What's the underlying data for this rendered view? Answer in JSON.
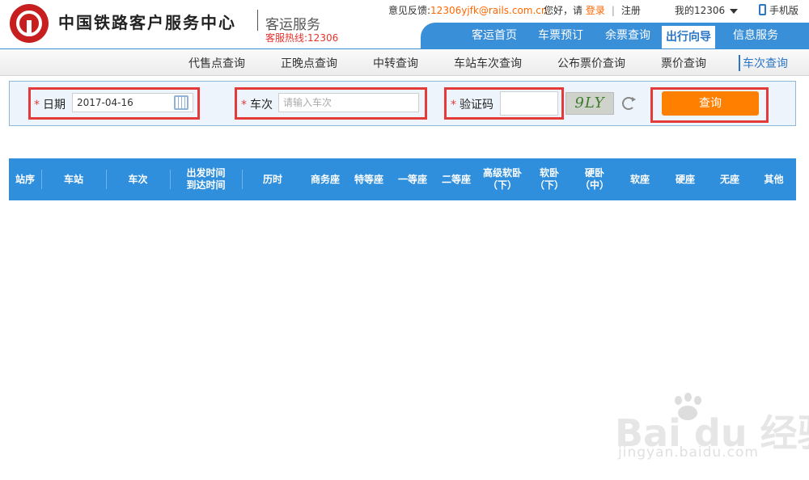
{
  "header": {
    "org_name": "中国铁路客户服务中心",
    "sub_name": "客运服务",
    "hotline": "客服热线:12306",
    "feedback_label": "意见反馈:",
    "feedback_email": "12306yjfk@rails.com.cn",
    "greeting": "您好，请",
    "login": "登录",
    "register": "注册",
    "my_account": "我的12306",
    "mobile": "手机版"
  },
  "nav": {
    "items": [
      "客运首页",
      "车票预订",
      "余票查询",
      "出行向导",
      "信息服务"
    ],
    "active": "出行向导"
  },
  "subnav": {
    "items": [
      "代售点查询",
      "正晚点查询",
      "中转查询",
      "车站车次查询",
      "公布票价查询",
      "票价查询",
      "车次查询"
    ],
    "active": "车次查询"
  },
  "search": {
    "date_label": "日期",
    "date_value": "2017-04-16",
    "train_label": "车次",
    "train_placeholder": "请输入车次",
    "captcha_label": "验证码",
    "captcha_value": "",
    "captcha_text": "9LY",
    "query_button": "查询",
    "required_mark": "*"
  },
  "table": {
    "columns": [
      "站序",
      "车站",
      "车次",
      "出发时间\n到达时间",
      "历时",
      "商务座",
      "特等座",
      "一等座",
      "二等座",
      "高级软卧\n（下）",
      "软卧\n（下）",
      "硬卧\n（中）",
      "软座",
      "硬座",
      "无座",
      "其他"
    ]
  },
  "watermark": {
    "brand": "Bai du 经验",
    "url": "jingyan.baidu.com"
  },
  "colors": {
    "primary_blue": "#3a8fd9",
    "table_blue": "#2f8fdc",
    "orange": "#ff8000",
    "highlight_red": "#e33a3a",
    "logo_red": "#c71f1f"
  }
}
